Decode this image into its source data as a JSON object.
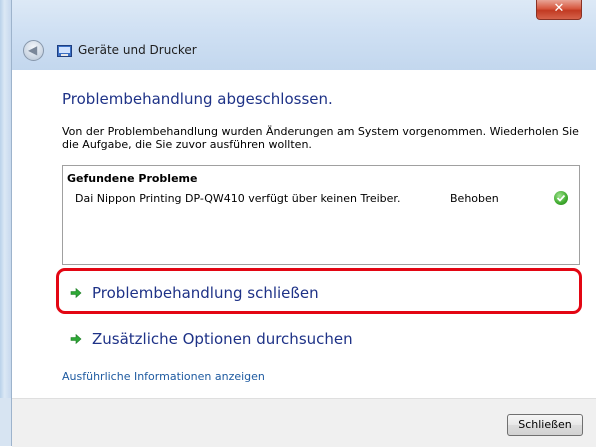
{
  "window": {
    "title": "Geräte und Drucker",
    "close_glyph": "✕"
  },
  "content": {
    "heading": "Problembehandlung abgeschlossen.",
    "description": "Von der Problembehandlung wurden Änderungen am System vorgenommen. Wiederholen Sie die Aufgabe, die Sie zuvor ausführen wollten.",
    "problems": {
      "heading": "Gefundene Probleme",
      "items": [
        {
          "text": "Dai Nippon Printing DP-QW410 verfügt über keinen Treiber.",
          "status": "Behoben",
          "status_icon": "green-check-icon"
        }
      ]
    },
    "actions": [
      {
        "label": "Problembehandlung schließen",
        "icon": "green-arrow-icon",
        "highlighted": true
      },
      {
        "label": "Zusätzliche Optionen durchsuchen",
        "icon": "green-arrow-icon",
        "highlighted": false
      }
    ],
    "details_link": "Ausführliche Informationen anzeigen"
  },
  "footer": {
    "close_button": "Schließen"
  },
  "colors": {
    "heading": "#1e3287",
    "highlight_border": "#e30613",
    "link": "#1e5aa0"
  }
}
